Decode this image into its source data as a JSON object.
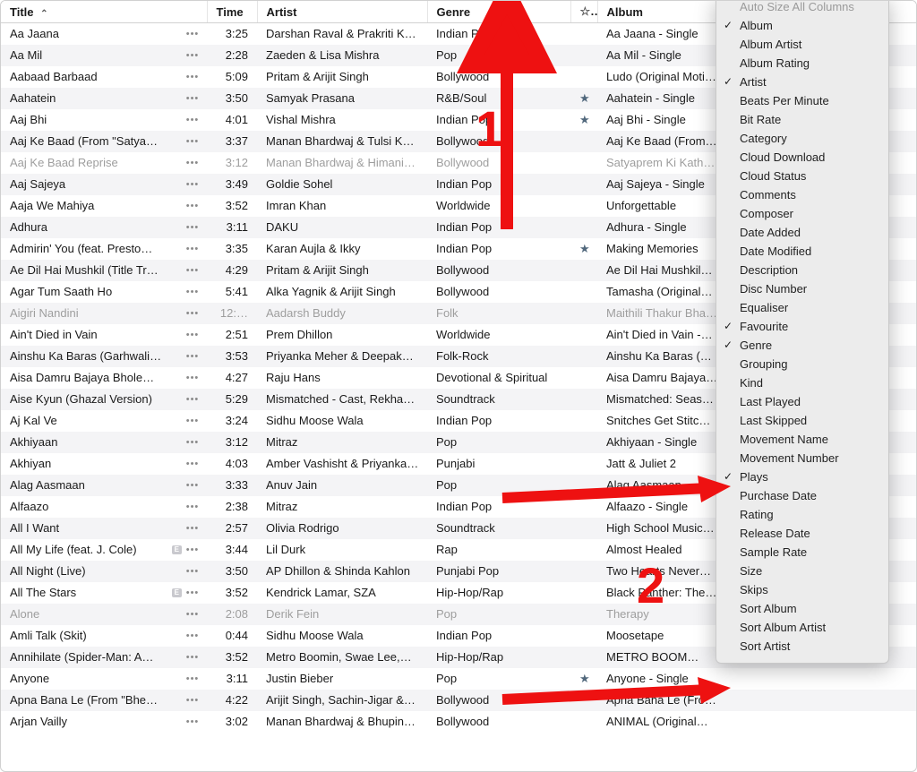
{
  "columns": {
    "title": "Title",
    "time": "Time",
    "artist": "Artist",
    "genre": "Genre",
    "album": "Album"
  },
  "rows": [
    {
      "title": "Aa Jaana",
      "explicit": false,
      "time": "3:25",
      "artist": "Darshan Raval & Prakriti K…",
      "genre": "Indian Pop",
      "fav": false,
      "album": "Aa Jaana - Single",
      "unavail": false
    },
    {
      "title": "Aa Mil",
      "explicit": false,
      "time": "2:28",
      "artist": "Zaeden & Lisa Mishra",
      "genre": "Pop",
      "fav": false,
      "album": "Aa Mil - Single",
      "unavail": false
    },
    {
      "title": "Aabaad Barbaad",
      "explicit": false,
      "time": "5:09",
      "artist": "Pritam & Arijit Singh",
      "genre": "Bollywood",
      "fav": false,
      "album": "Ludo (Original Moti…",
      "unavail": false
    },
    {
      "title": "Aahatein",
      "explicit": false,
      "time": "3:50",
      "artist": "Samyak Prasana",
      "genre": "R&B/Soul",
      "fav": true,
      "album": "Aahatein - Single",
      "unavail": false
    },
    {
      "title": "Aaj Bhi",
      "explicit": false,
      "time": "4:01",
      "artist": "Vishal Mishra",
      "genre": "Indian Pop",
      "fav": true,
      "album": "Aaj Bhi - Single",
      "unavail": false
    },
    {
      "title": "Aaj Ke Baad (From \"Satya…",
      "explicit": false,
      "time": "3:37",
      "artist": "Manan Bhardwaj & Tulsi Ku…",
      "genre": "Bollywood",
      "fav": false,
      "album": "Aaj Ke Baad (From…",
      "unavail": false
    },
    {
      "title": "Aaj Ke Baad Reprise",
      "explicit": false,
      "time": "3:12",
      "artist": "Manan Bhardwaj & Himani…",
      "genre": "Bollywood",
      "fav": false,
      "album": "Satyaprem Ki Kath…",
      "unavail": true
    },
    {
      "title": "Aaj Sajeya",
      "explicit": false,
      "time": "3:49",
      "artist": "Goldie Sohel",
      "genre": "Indian Pop",
      "fav": false,
      "album": "Aaj Sajeya - Single",
      "unavail": false
    },
    {
      "title": "Aaja We Mahiya",
      "explicit": false,
      "time": "3:52",
      "artist": "Imran Khan",
      "genre": "Worldwide",
      "fav": false,
      "album": "Unforgettable",
      "unavail": false
    },
    {
      "title": "Adhura",
      "explicit": false,
      "time": "3:11",
      "artist": "DAKU",
      "genre": "Indian Pop",
      "fav": false,
      "album": "Adhura - Single",
      "unavail": false
    },
    {
      "title": "Admirin' You (feat. Presto…",
      "explicit": false,
      "time": "3:35",
      "artist": "Karan Aujla & Ikky",
      "genre": "Indian Pop",
      "fav": true,
      "album": "Making Memories",
      "unavail": false
    },
    {
      "title": "Ae Dil Hai Mushkil (Title Tr…",
      "explicit": false,
      "time": "4:29",
      "artist": "Pritam & Arijit Singh",
      "genre": "Bollywood",
      "fav": false,
      "album": "Ae Dil Hai Mushkil…",
      "unavail": false
    },
    {
      "title": "Agar Tum Saath Ho",
      "explicit": false,
      "time": "5:41",
      "artist": "Alka Yagnik & Arijit Singh",
      "genre": "Bollywood",
      "fav": false,
      "album": "Tamasha (Original…",
      "unavail": false
    },
    {
      "title": "Aigiri Nandini",
      "explicit": false,
      "time": "12:…",
      "artist": "Aadarsh Buddy",
      "genre": "Folk",
      "fav": false,
      "album": "Maithili Thakur Bha…",
      "unavail": true
    },
    {
      "title": "Ain't Died in Vain",
      "explicit": false,
      "time": "2:51",
      "artist": "Prem Dhillon",
      "genre": "Worldwide",
      "fav": false,
      "album": "Ain't Died in Vain -…",
      "unavail": false
    },
    {
      "title": "Ainshu Ka Baras (Garhwali…",
      "explicit": false,
      "time": "3:53",
      "artist": "Priyanka Meher & Deepak…",
      "genre": "Folk-Rock",
      "fav": false,
      "album": "Ainshu Ka Baras (…",
      "unavail": false
    },
    {
      "title": "Aisa Damru Bajaya Bhole…",
      "explicit": false,
      "time": "4:27",
      "artist": "Raju Hans",
      "genre": "Devotional & Spiritual",
      "fav": false,
      "album": "Aisa Damru Bajaya…",
      "unavail": false
    },
    {
      "title": "Aise Kyun (Ghazal Version)",
      "explicit": false,
      "time": "5:29",
      "artist": "Mismatched - Cast, Rekha…",
      "genre": "Soundtrack",
      "fav": false,
      "album": "Mismatched: Seas…",
      "unavail": false
    },
    {
      "title": "Aj Kal Ve",
      "explicit": false,
      "time": "3:24",
      "artist": "Sidhu Moose Wala",
      "genre": "Indian Pop",
      "fav": false,
      "album": "Snitches Get Stitc…",
      "unavail": false
    },
    {
      "title": "Akhiyaan",
      "explicit": false,
      "time": "3:12",
      "artist": "Mitraz",
      "genre": "Pop",
      "fav": false,
      "album": "Akhiyaan - Single",
      "unavail": false
    },
    {
      "title": "Akhiyan",
      "explicit": false,
      "time": "4:03",
      "artist": "Amber Vashisht & Priyanka…",
      "genre": "Punjabi",
      "fav": false,
      "album": "Jatt & Juliet 2",
      "unavail": false
    },
    {
      "title": "Alag Aasmaan",
      "explicit": false,
      "time": "3:33",
      "artist": "Anuv Jain",
      "genre": "Pop",
      "fav": false,
      "album": "Alag Aasmaan -…",
      "unavail": false
    },
    {
      "title": "Alfaazo",
      "explicit": false,
      "time": "2:38",
      "artist": "Mitraz",
      "genre": "Indian Pop",
      "fav": false,
      "album": "Alfaazo - Single",
      "unavail": false
    },
    {
      "title": "All I Want",
      "explicit": false,
      "time": "2:57",
      "artist": "Olivia Rodrigo",
      "genre": "Soundtrack",
      "fav": false,
      "album": "High School Music…",
      "unavail": false
    },
    {
      "title": "All My Life (feat. J. Cole)",
      "explicit": true,
      "time": "3:44",
      "artist": "Lil Durk",
      "genre": "Rap",
      "fav": false,
      "album": "Almost Healed",
      "unavail": false
    },
    {
      "title": "All Night (Live)",
      "explicit": false,
      "time": "3:50",
      "artist": "AP Dhillon & Shinda Kahlon",
      "genre": "Punjabi Pop",
      "fav": false,
      "album": "Two Hearts Never…",
      "unavail": false
    },
    {
      "title": "All The Stars",
      "explicit": true,
      "time": "3:52",
      "artist": "Kendrick Lamar, SZA",
      "genre": "Hip-Hop/Rap",
      "fav": false,
      "album": "Black Panther: The…",
      "unavail": false
    },
    {
      "title": "Alone",
      "explicit": false,
      "time": "2:08",
      "artist": "Derik Fein",
      "genre": "Pop",
      "fav": false,
      "album": "Therapy",
      "unavail": true
    },
    {
      "title": "Amli Talk (Skit)",
      "explicit": false,
      "time": "0:44",
      "artist": "Sidhu Moose Wala",
      "genre": "Indian Pop",
      "fav": false,
      "album": "Moosetape",
      "unavail": false
    },
    {
      "title": "Annihilate (Spider-Man: A…",
      "explicit": false,
      "time": "3:52",
      "artist": "Metro Boomin, Swae Lee,…",
      "genre": "Hip-Hop/Rap",
      "fav": false,
      "album": "METRO BOOM…",
      "unavail": false
    },
    {
      "title": "Anyone",
      "explicit": false,
      "time": "3:11",
      "artist": "Justin Bieber",
      "genre": "Pop",
      "fav": true,
      "album": "Anyone - Single",
      "unavail": false
    },
    {
      "title": "Apna Bana Le (From \"Bhe…",
      "explicit": false,
      "time": "4:22",
      "artist": "Arijit Singh, Sachin-Jigar &…",
      "genre": "Bollywood",
      "fav": false,
      "album": "Apna Bana Le (Fro…",
      "unavail": false
    },
    {
      "title": "Arjan Vailly",
      "explicit": false,
      "time": "3:02",
      "artist": "Manan Bhardwaj & Bhupin…",
      "genre": "Bollywood",
      "fav": false,
      "album": "ANIMAL (Original…",
      "unavail": false
    }
  ],
  "menu": {
    "header": "Auto Size All Columns",
    "items": [
      {
        "label": "Album",
        "checked": true
      },
      {
        "label": "Album Artist",
        "checked": false
      },
      {
        "label": "Album Rating",
        "checked": false
      },
      {
        "label": "Artist",
        "checked": true
      },
      {
        "label": "Beats Per Minute",
        "checked": false
      },
      {
        "label": "Bit Rate",
        "checked": false
      },
      {
        "label": "Category",
        "checked": false
      },
      {
        "label": "Cloud Download",
        "checked": false
      },
      {
        "label": "Cloud Status",
        "checked": false
      },
      {
        "label": "Comments",
        "checked": false
      },
      {
        "label": "Composer",
        "checked": false
      },
      {
        "label": "Date Added",
        "checked": false
      },
      {
        "label": "Date Modified",
        "checked": false
      },
      {
        "label": "Description",
        "checked": false
      },
      {
        "label": "Disc Number",
        "checked": false
      },
      {
        "label": "Equaliser",
        "checked": false
      },
      {
        "label": "Favourite",
        "checked": true
      },
      {
        "label": "Genre",
        "checked": true
      },
      {
        "label": "Grouping",
        "checked": false
      },
      {
        "label": "Kind",
        "checked": false
      },
      {
        "label": "Last Played",
        "checked": false
      },
      {
        "label": "Last Skipped",
        "checked": false
      },
      {
        "label": "Movement Name",
        "checked": false
      },
      {
        "label": "Movement Number",
        "checked": false
      },
      {
        "label": "Plays",
        "checked": true
      },
      {
        "label": "Purchase Date",
        "checked": false
      },
      {
        "label": "Rating",
        "checked": false
      },
      {
        "label": "Release Date",
        "checked": false
      },
      {
        "label": "Sample Rate",
        "checked": false
      },
      {
        "label": "Size",
        "checked": false
      },
      {
        "label": "Skips",
        "checked": false
      },
      {
        "label": "Sort Album",
        "checked": false
      },
      {
        "label": "Sort Album Artist",
        "checked": false
      },
      {
        "label": "Sort Artist",
        "checked": false
      }
    ]
  },
  "annotations": {
    "label1": "1",
    "label2": "2"
  }
}
